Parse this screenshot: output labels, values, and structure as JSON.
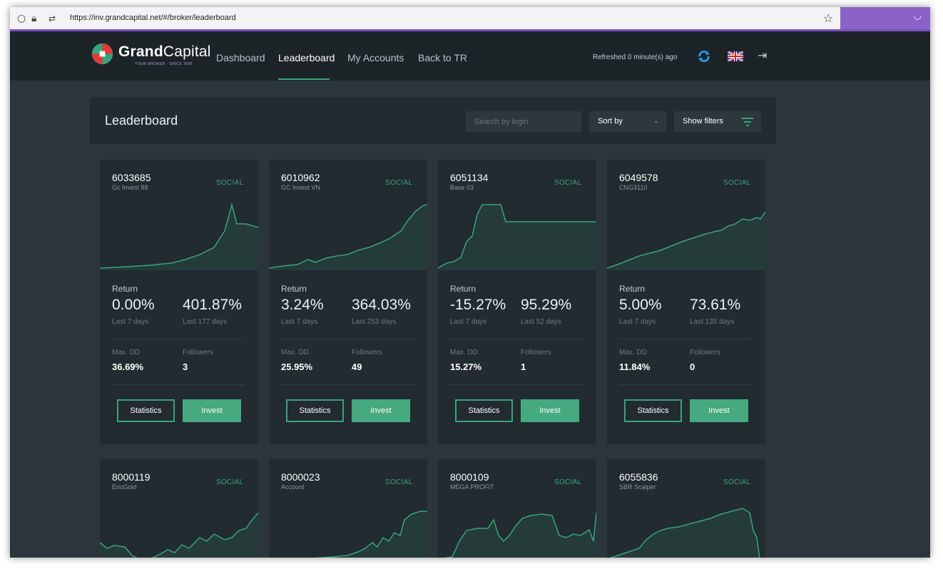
{
  "browser": {
    "url": "https://inv.grandcapital.net/#/broker/leaderboard"
  },
  "brand": {
    "name_bold": "Grand",
    "name_light": "Capital",
    "tagline": "YOUR BROKER · SINCE 2006"
  },
  "nav": {
    "links": [
      "Dashboard",
      "Leaderboard",
      "My Accounts",
      "Back to TR"
    ],
    "active": "Leaderboard",
    "refresh_text": "Refreshed 0 minute(s) ago"
  },
  "leaderboard": {
    "title": "Leaderboard",
    "search_placeholder": "Search by login",
    "sort_label": "Sort by",
    "filters_label": "Show filters"
  },
  "labels": {
    "social": "SOCIAL",
    "return": "Return",
    "max_dd": "Max. DD",
    "followers": "Followers",
    "statistics": "Statistics",
    "invest": "Invest",
    "last7": "Last 7 days"
  },
  "cards": [
    {
      "id": "6033685",
      "name": "Gc Invest 88",
      "return_7d": "0.00%",
      "return_total": "401.87%",
      "total_period": "Last 177 days",
      "max_dd": "36.69%",
      "followers": "3"
    },
    {
      "id": "6010962",
      "name": "GC Invest VN",
      "return_7d": "3.24%",
      "return_total": "364.03%",
      "total_period": "Last 253 days",
      "max_dd": "25.95%",
      "followers": "49"
    },
    {
      "id": "6051134",
      "name": "Base 03",
      "return_7d": "-15.27%",
      "return_total": "95.29%",
      "total_period": "Last 52 days",
      "max_dd": "15.27%",
      "followers": "1"
    },
    {
      "id": "6049578",
      "name": "CNG3110",
      "return_7d": "5.00%",
      "return_total": "73.61%",
      "total_period": "Last 135 days",
      "max_dd": "11.84%",
      "followers": "0"
    },
    {
      "id": "8000119",
      "name": "EricGold"
    },
    {
      "id": "8000023",
      "name": "Account"
    },
    {
      "id": "8000109",
      "name": "MEGA PROFIT"
    },
    {
      "id": "6055836",
      "name": "SBR Scalper"
    }
  ],
  "colors": {
    "accent": "#3aa37a",
    "background": "#2b363c",
    "card": "#212b30",
    "nav": "#1c2428"
  }
}
